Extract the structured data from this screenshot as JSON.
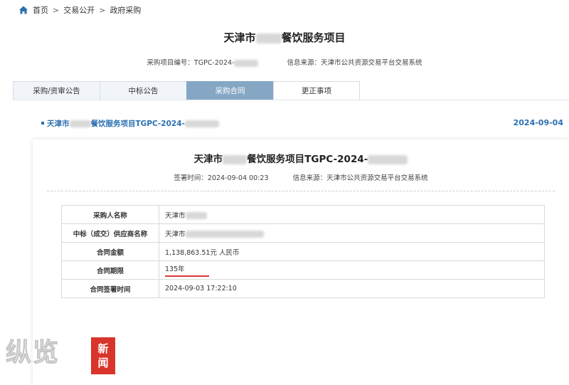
{
  "breadcrumb": {
    "home": "首页",
    "sep": ">",
    "level2": "交易公开",
    "level3": "政府采购"
  },
  "page_title": {
    "prefix": "天津市",
    "suffix": "餐饮服务项目"
  },
  "meta": {
    "project_no_label": "采购项目编号：TGPC-2024-",
    "source": "信息来源：天津市公共资源交易平台交易系统"
  },
  "tabs": [
    "采购/资审公告",
    "中标公告",
    "采购合同",
    "更正事项"
  ],
  "active_tab": "采购合同",
  "list_item": {
    "link_prefix": "天津市",
    "link_suffix": "餐饮服务项目TGPC-2024-",
    "date": "2024-09-04"
  },
  "detail": {
    "title_prefix": "天津市",
    "title_suffix": "餐饮服务项目TGPC-2024-",
    "sign_time": "签署时间：2024-09-04 00:23",
    "source": "信息来源：天津市公共资源交易平台交易系统"
  },
  "table": [
    {
      "key": "采购人名称",
      "value": "天津市"
    },
    {
      "key": "中标（成交）供应商名称",
      "value": "天津市"
    },
    {
      "key": "合同金额",
      "value": "1,138,863.51元 人民币"
    },
    {
      "key": "合同期限",
      "value": "135年"
    },
    {
      "key": "合同签署时间",
      "value": "2024-09-03 17:22:10"
    }
  ],
  "watermark": {
    "text": "纵览",
    "badge1": "新",
    "badge2": "闻"
  },
  "colors": {
    "link": "#2a6fb0",
    "active_tab": "#86a7c4",
    "highlight": "#d83a3a"
  }
}
